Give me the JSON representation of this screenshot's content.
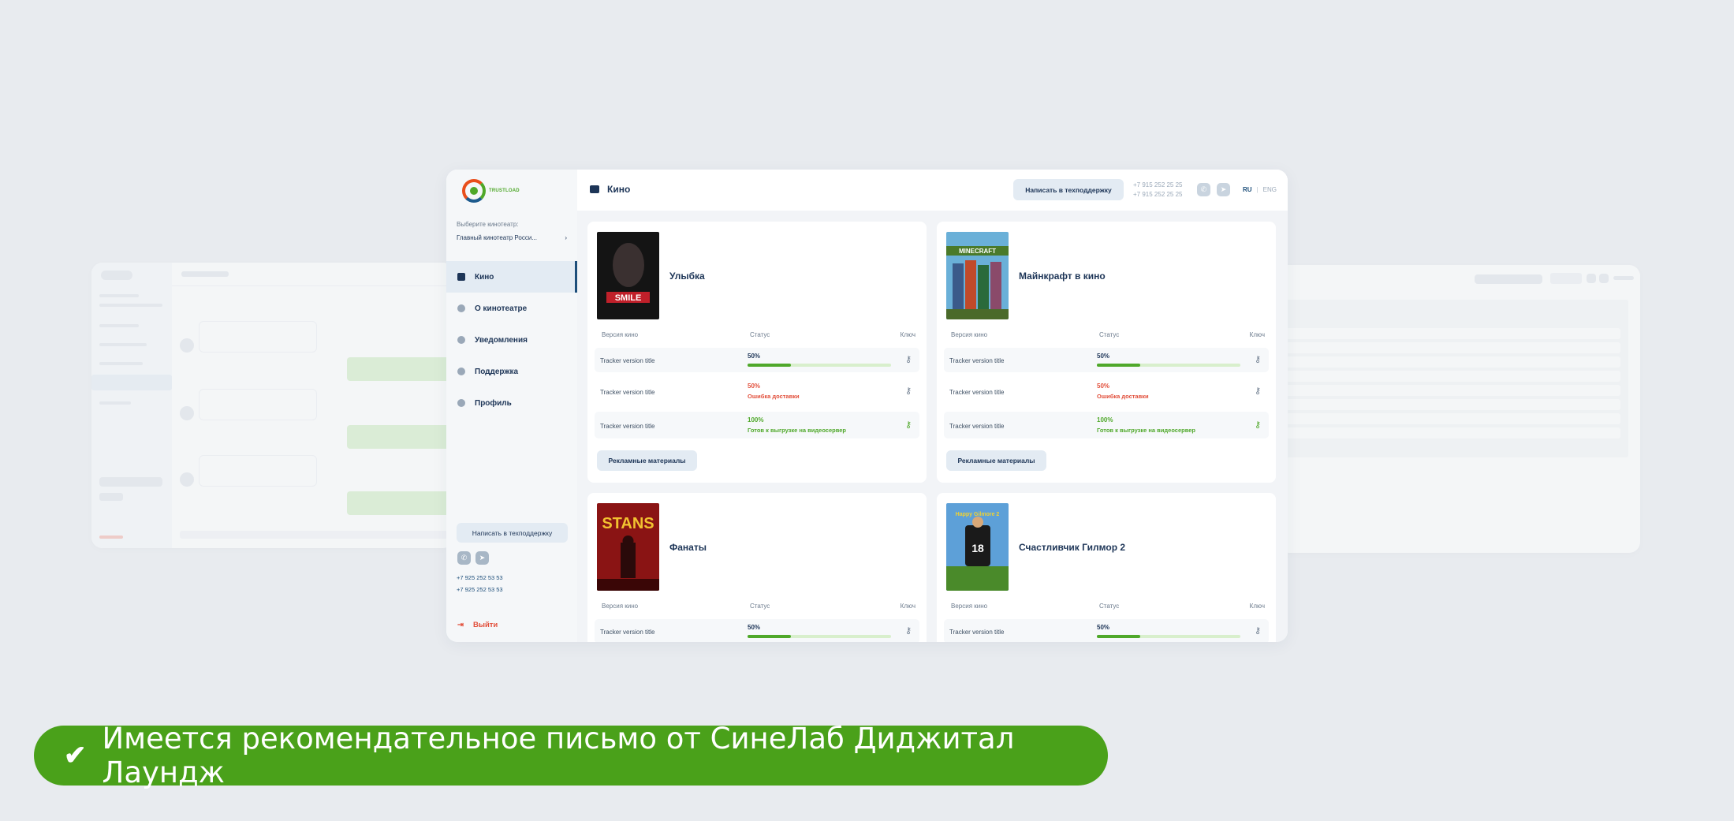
{
  "main_window": {
    "logo_text": "TRUSTLOAD",
    "sidebar": {
      "cinema_label": "Выберите кинотеатр:",
      "cinema_selected": "Главный кинотеатр Росси...",
      "nav": [
        {
          "label": "Кино",
          "icon": "film-icon",
          "active": true
        },
        {
          "label": "О кинотеатре",
          "icon": "info-icon",
          "active": false
        },
        {
          "label": "Уведомления",
          "icon": "bell-icon",
          "active": false
        },
        {
          "label": "Поддержка",
          "icon": "support-icon",
          "active": false
        },
        {
          "label": "Профиль",
          "icon": "user-icon",
          "active": false
        }
      ],
      "support_button": "Написать в техподдержку",
      "phones": [
        "+7 925 252 53 53",
        "+7 925 252 53 53"
      ],
      "logout": "Выйти"
    },
    "topbar": {
      "title": "Кино",
      "support_button": "Написать в техподдержку",
      "phones": [
        "+7 915 252 25 25",
        "+7 915 252 25 25"
      ],
      "lang_active": "RU",
      "lang_inactive": "ENG"
    },
    "columns": {
      "version": "Версия кино",
      "status": "Статус",
      "key": "Ключ"
    },
    "promo_button": "Рекламные материалы",
    "films": [
      {
        "title": "Улыбка",
        "rows": [
          {
            "version": "Tracker version title",
            "percent": "50%",
            "progress": 0.3,
            "message": "",
            "state": "progress"
          },
          {
            "version": "Tracker version title",
            "percent": "50%",
            "progress": null,
            "message": "Ошибка доставки",
            "state": "error"
          },
          {
            "version": "Tracker version title",
            "percent": "100%",
            "progress": null,
            "message": "Готов к выгрузке на видеосервер",
            "state": "done"
          }
        ]
      },
      {
        "title": "Майнкрафт в кино",
        "rows": [
          {
            "version": "Tracker version title",
            "percent": "50%",
            "progress": 0.3,
            "message": "",
            "state": "progress"
          },
          {
            "version": "Tracker version title",
            "percent": "50%",
            "progress": null,
            "message": "Ошибка доставки",
            "state": "error"
          },
          {
            "version": "Tracker version title",
            "percent": "100%",
            "progress": null,
            "message": "Готов к выгрузке на видеосервер",
            "state": "done"
          }
        ]
      },
      {
        "title": "Фанаты",
        "rows": [
          {
            "version": "Tracker version title",
            "percent": "50%",
            "progress": 0.3,
            "message": "",
            "state": "progress"
          }
        ]
      },
      {
        "title": "Счастливчик Гилмор 2",
        "rows": [
          {
            "version": "Tracker version title",
            "percent": "50%",
            "progress": 0.3,
            "message": "",
            "state": "progress"
          }
        ]
      }
    ]
  },
  "colors": {
    "brand_green": "#4aa11a",
    "error": "#e24f3b",
    "success": "#4fa82a",
    "navy": "#1d3557"
  },
  "banner": {
    "icon": "check-icon",
    "text": "Имеется рекомендательное письмо от СинеЛаб Диджитал Лаундж"
  }
}
